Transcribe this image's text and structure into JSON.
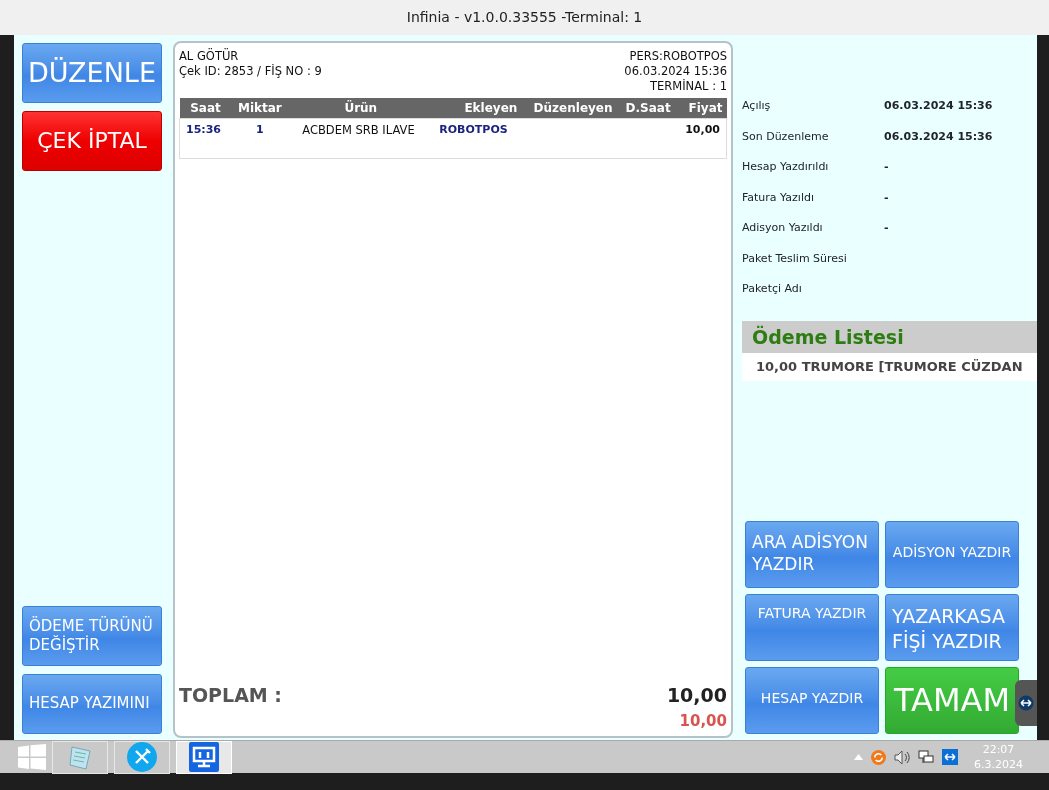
{
  "window": {
    "title": "Infinia - v1.0.0.33555 -Terminal: 1"
  },
  "left_top_buttons": [
    {
      "label": "DÜZENLE",
      "kind": "primary"
    },
    {
      "label": "ÇEK İPTAL",
      "kind": "danger"
    }
  ],
  "left_bottom_buttons": [
    {
      "label": "ÖDEME TÜRÜNÜ DEĞİŞTİR",
      "kind": "primary"
    },
    {
      "label": "HESAP YAZIMINI",
      "kind": "primary"
    }
  ],
  "receipt": {
    "header_left": [
      "AL GÖTÜR",
      "Çek ID: 2853 / FİŞ NO : 9"
    ],
    "header_right": [
      "PERS:ROBOTPOS",
      "06.03.2024 15:36",
      "TERMİNAL : 1"
    ],
    "columns": [
      "Saat",
      "Miktar",
      "Ürün",
      "Ekleyen",
      "Düzenleyen",
      "D.Saat",
      "Fiyat"
    ],
    "rows": [
      [
        "15:36",
        "1",
        "ACBDEM SRB ILAVE",
        "ROBOTPOS",
        "",
        "",
        "10,00"
      ]
    ],
    "total_label": "TOPLAM :",
    "total_value": "10,00",
    "paid_value": "10,00"
  },
  "info": [
    {
      "label": "Açılış",
      "value": "06.03.2024 15:36"
    },
    {
      "label": "Son Düzenleme",
      "value": "06.03.2024 15:36"
    },
    {
      "label": "Hesap Yazdırıldı",
      "value": "-"
    },
    {
      "label": "Fatura Yazıldı",
      "value": "-"
    },
    {
      "label": "Adisyon Yazıldı",
      "value": "-"
    },
    {
      "label": "Paket Teslim Süresi"
    },
    {
      "label": "Paketçi Adı"
    }
  ],
  "payment_list": {
    "title": "Ödeme Listesi",
    "items": [
      "10,00 TRUMORE [TRUMORE CÜZDAN"
    ]
  },
  "action_buttons": [
    {
      "label": "ARA ADİSYON YAZDIR",
      "kind": "blue"
    },
    {
      "label": "ADİSYON YAZDIR",
      "kind": "blue"
    },
    {
      "label": "FATURA YAZDIR",
      "kind": "blue"
    },
    {
      "label": "YAZARKASA FİŞİ YAZDIR",
      "kind": "blue"
    },
    {
      "label": "HESAP YAZDIR",
      "kind": "blue"
    },
    {
      "label": "TAMAM",
      "kind": "green"
    }
  ],
  "taskbar": {
    "apps": [
      {
        "kind": "notepad",
        "selected": false
      },
      {
        "kind": "restaurant",
        "selected": false
      },
      {
        "kind": "monitor",
        "selected": true
      }
    ],
    "time": "22:07",
    "date": "6.3.2024"
  }
}
